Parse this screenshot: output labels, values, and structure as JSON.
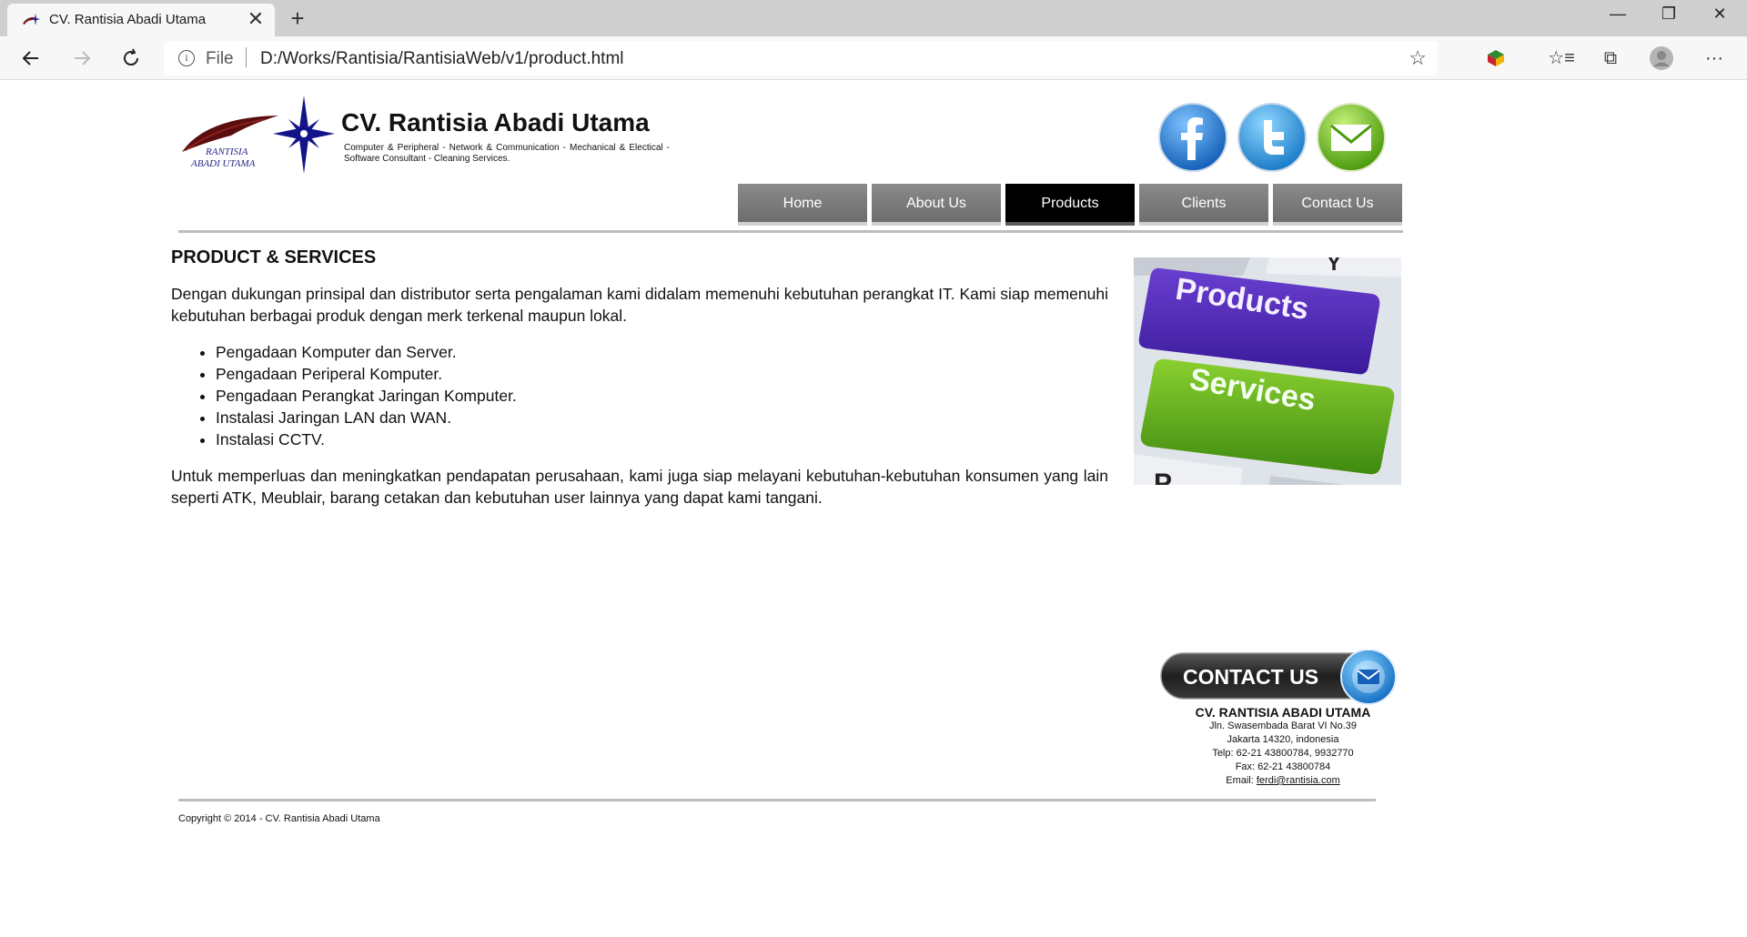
{
  "browser": {
    "tab_title": "CV. Rantisia Abadi Utama",
    "tab_close": "✕",
    "new_tab": "+",
    "window_controls": {
      "minimize": "—",
      "restore": "❐",
      "close": "✕"
    },
    "url_scheme": "File",
    "url": "D:/Works/Rantisia/RantisiaWeb/v1/product.html",
    "icons": [
      "back-icon",
      "forward-icon",
      "refresh-icon",
      "info-icon",
      "favorite-star-icon",
      "extension-icon",
      "favorites-icon",
      "collections-icon",
      "profile-icon",
      "more-icon"
    ]
  },
  "header": {
    "logo_text_line1": "RANTISIA",
    "logo_text_line2": "ABADI UTAMA",
    "title": "CV. Rantisia Abadi Utama",
    "tagline": "Computer & Peripheral - Network & Communication - Mechanical & Electical - Software Consultant - Cleaning Services.",
    "social": [
      "facebook-icon",
      "twitter-icon",
      "email-icon"
    ]
  },
  "menu": {
    "items": [
      {
        "label": "Home",
        "active": false
      },
      {
        "label": "About Us",
        "active": false
      },
      {
        "label": "Products",
        "active": true
      },
      {
        "label": "Clients",
        "active": false
      },
      {
        "label": "Contact Us",
        "active": false
      }
    ]
  },
  "content": {
    "heading": "PRODUCT & SERVICES",
    "intro": "Dengan dukungan prinsipal dan distributor serta pengalaman kami didalam memenuhi kebutuhan perangkat IT. Kami siap memenuhi kebutuhan berbagai produk dengan merk terkenal maupun lokal.",
    "list": [
      "Pengadaan Komputer dan Server.",
      "Pengadaan Periperal Komputer.",
      "Pengadaan Perangkat Jaringan Komputer.",
      "Instalasi Jaringan LAN dan WAN.",
      "Instalasi CCTV."
    ],
    "outro": "Untuk memperluas dan meningkatkan pendapatan perusahaan, kami juga siap melayani kebutuhan-kebutuhan konsumen yang lain seperti ATK, Meublair, barang cetakan dan kebutuhan user lainnya yang dapat kami tangani.",
    "image_key1": "Products",
    "image_key2": "Services"
  },
  "contact": {
    "banner_label": "CONTACT US",
    "company": "CV. RANTISIA ABADI UTAMA",
    "address1": "Jln. Swasembada Barat VI No.39",
    "address2": "Jakarta 14320, indonesia",
    "telp": "Telp: 62-21 43800784, 9932770",
    "fax": "Fax: 62-21 43800784",
    "email_label": "Email:",
    "email": "ferdi@rantisia.com"
  },
  "footer": {
    "copyright": "Copyright © 2014 - CV. Rantisia Abadi Utama"
  }
}
